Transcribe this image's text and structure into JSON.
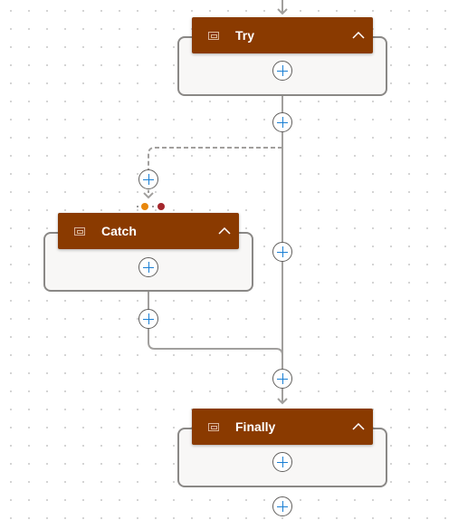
{
  "canvas": {
    "type": "flow-designer",
    "grid": "dotted"
  },
  "colors": {
    "header_bg": "#8a3a00",
    "plus_accent": "#1a7fd4",
    "run_after_failed": "#e8870c",
    "run_after_timedout": "#a4262c",
    "connector": "#a19f9d"
  },
  "scopes": [
    {
      "id": "try",
      "label": "Try",
      "icon": "scope-icon",
      "collapse_icon": "chevron-up-icon"
    },
    {
      "id": "catch",
      "label": "Catch",
      "icon": "scope-icon",
      "collapse_icon": "chevron-up-icon"
    },
    {
      "id": "finally",
      "label": "Finally",
      "icon": "scope-icon",
      "collapse_icon": "chevron-up-icon"
    }
  ],
  "add_buttons": [
    {
      "name": "add-action-in-try"
    },
    {
      "name": "add-step-after-try"
    },
    {
      "name": "add-step-before-catch"
    },
    {
      "name": "add-action-in-catch"
    },
    {
      "name": "add-step-parallel-branch"
    },
    {
      "name": "add-step-after-catch"
    },
    {
      "name": "add-step-before-finally"
    },
    {
      "name": "add-action-in-finally"
    },
    {
      "name": "add-step-after-finally"
    }
  ],
  "run_after_indicators": [
    "failed",
    "timed-out"
  ]
}
